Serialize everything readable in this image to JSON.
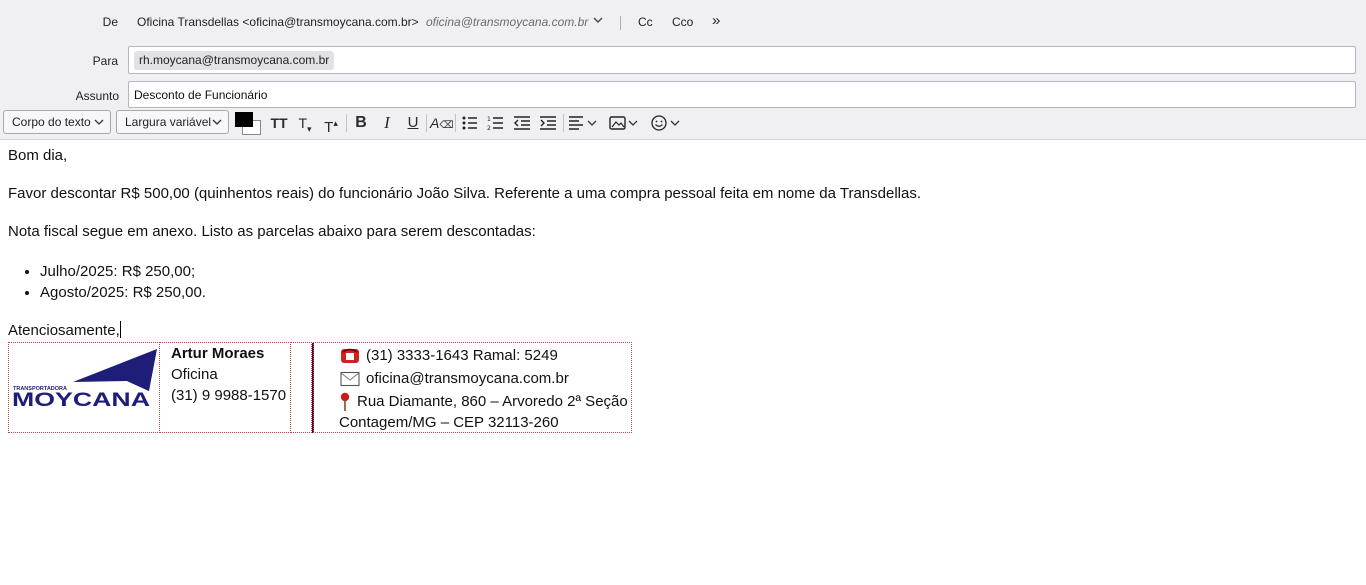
{
  "header": {
    "from_label": "De",
    "from_value": "Oficina Transdellas <oficina@transmoycana.com.br>",
    "from_identity": "oficina@transmoycana.com.br",
    "cc_label": "Cc",
    "bcc_label": "Cco",
    "more_label": "»",
    "to_label": "Para",
    "to_recipient": "rh.moycana@transmoycana.com.br",
    "subject_label": "Assunto",
    "subject_value": "Desconto de Funcionário"
  },
  "toolbar": {
    "paragraph_format": "Corpo do texto",
    "font": "Largura variável",
    "text_color": "#000000"
  },
  "message": {
    "greeting": "Bom dia,",
    "line1": "Favor descontar R$ 500,00 (quinhentos reais) do funcionário João Silva. Referente a uma compra pessoal feita em nome da Transdellas.",
    "line2": "Nota fiscal segue em anexo. Listo as parcelas abaixo para serem descontadas:",
    "installments": [
      "Julho/2025: R$ 250,00;",
      "Agosto/2025: R$ 250,00."
    ],
    "closing": "Atenciosamente,"
  },
  "signature": {
    "logo_small": "TRANSPORTADORA",
    "logo_main": "MOYCANA",
    "name": "Artur Moraes",
    "department": "Oficina",
    "mobile": "(31) 9 9988-1570",
    "phone": "(31) 3333-1643 Ramal: 5249",
    "email": "oficina@transmoycana.com.br",
    "address1": "Rua Diamante, 860 – Arvoredo 2ª Seção",
    "address2": "Contagem/MG – CEP 32113-260",
    "brand_color": "#1e1e78"
  }
}
